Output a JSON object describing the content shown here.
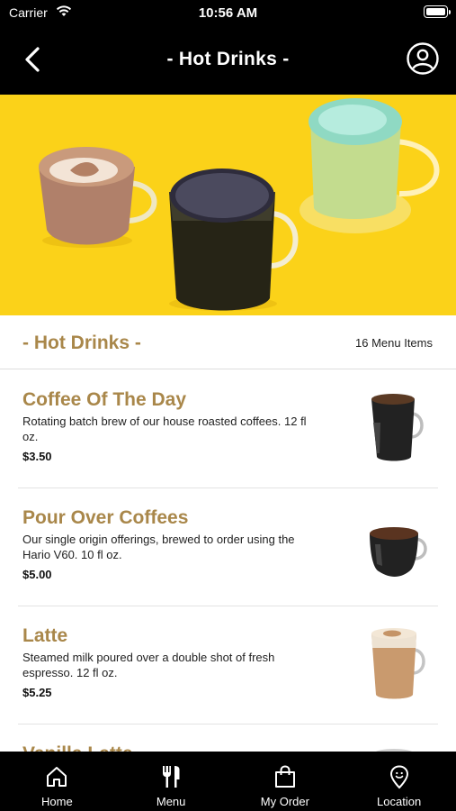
{
  "status_bar": {
    "carrier": "Carrier",
    "time": "10:56 AM"
  },
  "nav": {
    "title": "- Hot Drinks -",
    "back_icon": "chevron-left-icon",
    "profile_icon": "user-circle-icon"
  },
  "hero": {
    "background_color": "#fbd219"
  },
  "section": {
    "title": "- Hot Drinks -",
    "count": "16 Menu Items"
  },
  "items": [
    {
      "name": "Coffee Of The Day",
      "description": "Rotating batch brew of our house roasted coffees. 12 fl oz.",
      "price": "$3.50"
    },
    {
      "name": "Pour Over Coffees",
      "description": "Our single origin offerings, brewed to order using the Hario V60. 10 fl oz.",
      "price": "$5.00"
    },
    {
      "name": "Latte",
      "description": "Steamed milk poured over a double shot of fresh espresso. 12 fl oz.",
      "price": "$5.25"
    },
    {
      "name": "Vanilla Latte",
      "description": "",
      "price": ""
    }
  ],
  "tabs": [
    {
      "label": "Home",
      "icon": "home-icon"
    },
    {
      "label": "Menu",
      "icon": "fork-knife-icon"
    },
    {
      "label": "My Order",
      "icon": "shopping-bag-icon"
    },
    {
      "label": "Location",
      "icon": "location-pin-icon"
    }
  ],
  "colors": {
    "accent": "#a9874a",
    "bar": "#000000"
  }
}
